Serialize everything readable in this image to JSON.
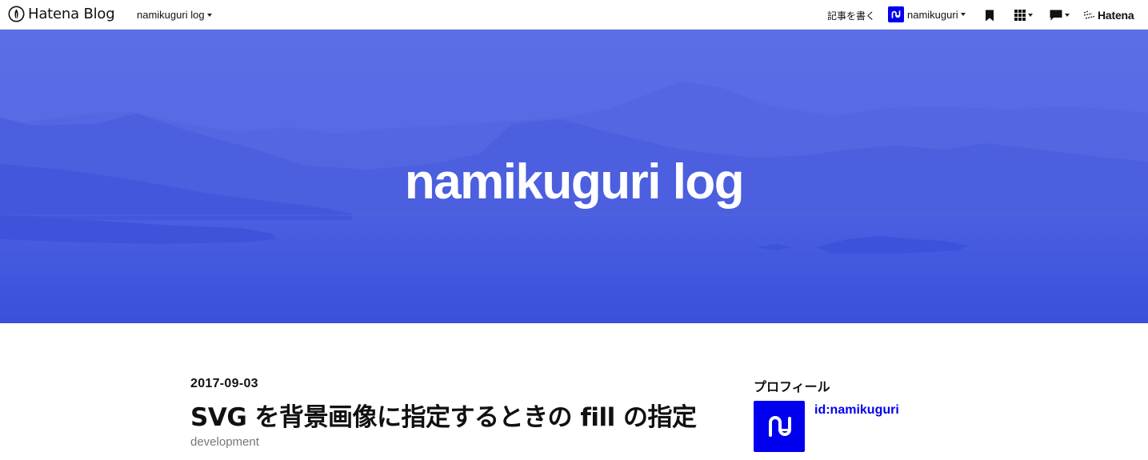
{
  "topbar": {
    "brand": "Hatena Blog",
    "blog_switch": "namikuguri log",
    "write_label": "記事を書く",
    "user_name": "namikuguri",
    "hatena_label": "Hatena",
    "icons": [
      "hatena-blog-logo-icon",
      "chevron-down-icon",
      "user-avatar-icon",
      "bookmark-icon",
      "apps-grid-icon",
      "notification-icon",
      "hatena-logo-icon"
    ]
  },
  "header": {
    "title": "namikuguri log",
    "background_color": "#4f63e2"
  },
  "entry": {
    "date": "2017-09-03",
    "title": "SVG を背景画像に指定するときの fill の指定",
    "category": "development"
  },
  "sidebar": {
    "profile_heading": "プロフィール",
    "profile_id": "id:namikuguri",
    "accent_color": "#0000ee"
  }
}
